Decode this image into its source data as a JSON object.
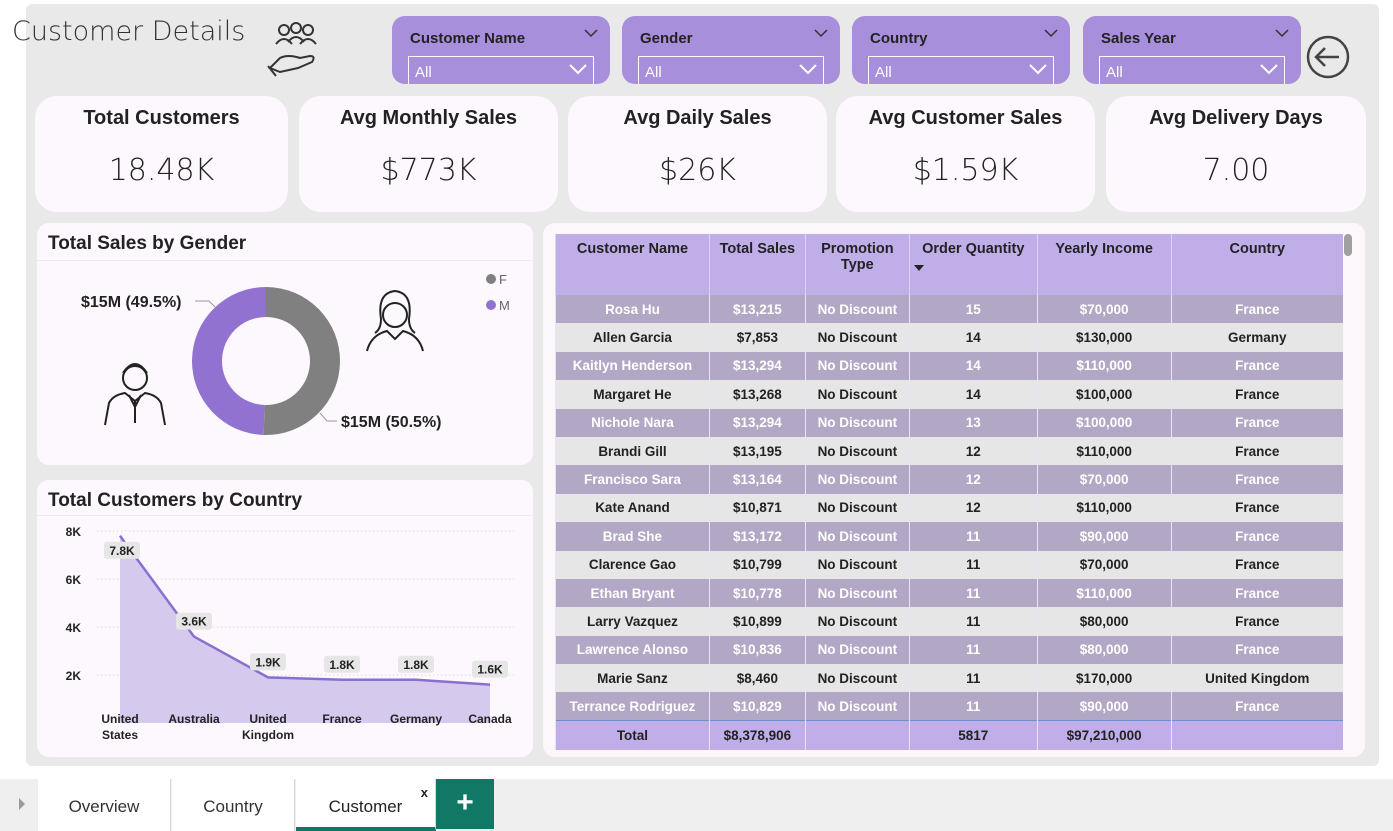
{
  "header": {
    "title": "Customer Details"
  },
  "slicers": [
    {
      "label": "Customer Name",
      "value": "All"
    },
    {
      "label": "Gender",
      "value": "All"
    },
    {
      "label": "Country",
      "value": "All"
    },
    {
      "label": "Sales Year",
      "value": "All"
    }
  ],
  "kpis": [
    {
      "label": "Total Customers",
      "value": "18.48K"
    },
    {
      "label": "Avg Monthly Sales",
      "value": "$773K"
    },
    {
      "label": "Avg Daily Sales",
      "value": "$26K"
    },
    {
      "label": "Avg Customer Sales",
      "value": "$1.59K"
    },
    {
      "label": "Avg Delivery Days",
      "value": "7.00"
    }
  ],
  "gender_chart": {
    "title": "Total Sales by Gender",
    "legend": [
      {
        "label": "F",
        "color": "#808080"
      },
      {
        "label": "M",
        "color": "#9272d0"
      }
    ],
    "chart_data": {
      "type": "pie",
      "categories": [
        "F",
        "M"
      ],
      "values": [
        50.5,
        49.5
      ],
      "data_labels": [
        "$15M (50.5%)",
        "$15M (49.5%)"
      ],
      "legend_position": "top-right"
    }
  },
  "country_chart": {
    "title": "Total Customers by Country",
    "chart_data": {
      "type": "area",
      "categories": [
        "United States",
        "Australia",
        "United Kingdom",
        "France",
        "Germany",
        "Canada"
      ],
      "category_lines": [
        [
          "United",
          "States"
        ],
        [
          "Australia"
        ],
        [
          "United",
          "Kingdom"
        ],
        [
          "France"
        ],
        [
          "Germany"
        ],
        [
          "Canada"
        ]
      ],
      "values": [
        7800,
        3600,
        1900,
        1800,
        1800,
        1600
      ],
      "data_labels": [
        "7.8K",
        "3.6K",
        "1.9K",
        "1.8K",
        "1.8K",
        "1.6K"
      ],
      "y_ticks": [
        "2K",
        "4K",
        "6K",
        "8K"
      ],
      "ylim": [
        0,
        8000
      ],
      "grid": true
    }
  },
  "table": {
    "columns": [
      [
        "Customer Name"
      ],
      [
        "Total Sales"
      ],
      [
        "Promotion",
        "Type"
      ],
      [
        "Order Quantity"
      ],
      [
        "Yearly Income"
      ],
      [
        "Country"
      ]
    ],
    "rows": [
      [
        "Rosa Hu",
        "$13,215",
        "No Discount",
        "15",
        "$70,000",
        "France"
      ],
      [
        "Allen Garcia",
        "$7,853",
        "No Discount",
        "14",
        "$130,000",
        "Germany"
      ],
      [
        "Kaitlyn Henderson",
        "$13,294",
        "No Discount",
        "14",
        "$110,000",
        "France"
      ],
      [
        "Margaret He",
        "$13,268",
        "No Discount",
        "14",
        "$100,000",
        "France"
      ],
      [
        "Nichole Nara",
        "$13,294",
        "No Discount",
        "13",
        "$100,000",
        "France"
      ],
      [
        "Brandi Gill",
        "$13,195",
        "No Discount",
        "12",
        "$110,000",
        "France"
      ],
      [
        "Francisco Sara",
        "$13,164",
        "No Discount",
        "12",
        "$70,000",
        "France"
      ],
      [
        "Kate Anand",
        "$10,871",
        "No Discount",
        "12",
        "$110,000",
        "France"
      ],
      [
        "Brad She",
        "$13,172",
        "No Discount",
        "11",
        "$90,000",
        "France"
      ],
      [
        "Clarence Gao",
        "$10,799",
        "No Discount",
        "11",
        "$70,000",
        "France"
      ],
      [
        "Ethan Bryant",
        "$10,778",
        "No Discount",
        "11",
        "$110,000",
        "France"
      ],
      [
        "Larry Vazquez",
        "$10,899",
        "No Discount",
        "11",
        "$80,000",
        "France"
      ],
      [
        "Lawrence Alonso",
        "$10,836",
        "No Discount",
        "11",
        "$80,000",
        "France"
      ],
      [
        "Marie Sanz",
        "$8,460",
        "No Discount",
        "11",
        "$170,000",
        "United Kingdom"
      ],
      [
        "Terrance Rodriguez",
        "$10,829",
        "No Discount",
        "11",
        "$90,000",
        "France"
      ]
    ],
    "total": [
      "Total",
      "$8,378,906",
      "",
      "5817",
      "$97,210,000",
      ""
    ]
  },
  "tabs": [
    {
      "label": "Overview"
    },
    {
      "label": "Country"
    },
    {
      "label": "Customer",
      "close": "x"
    }
  ],
  "add_tab": "+",
  "colors": {
    "accent": "#a78fdb",
    "male": "#9272d0",
    "female": "#808080",
    "tab_active": "#117865"
  }
}
